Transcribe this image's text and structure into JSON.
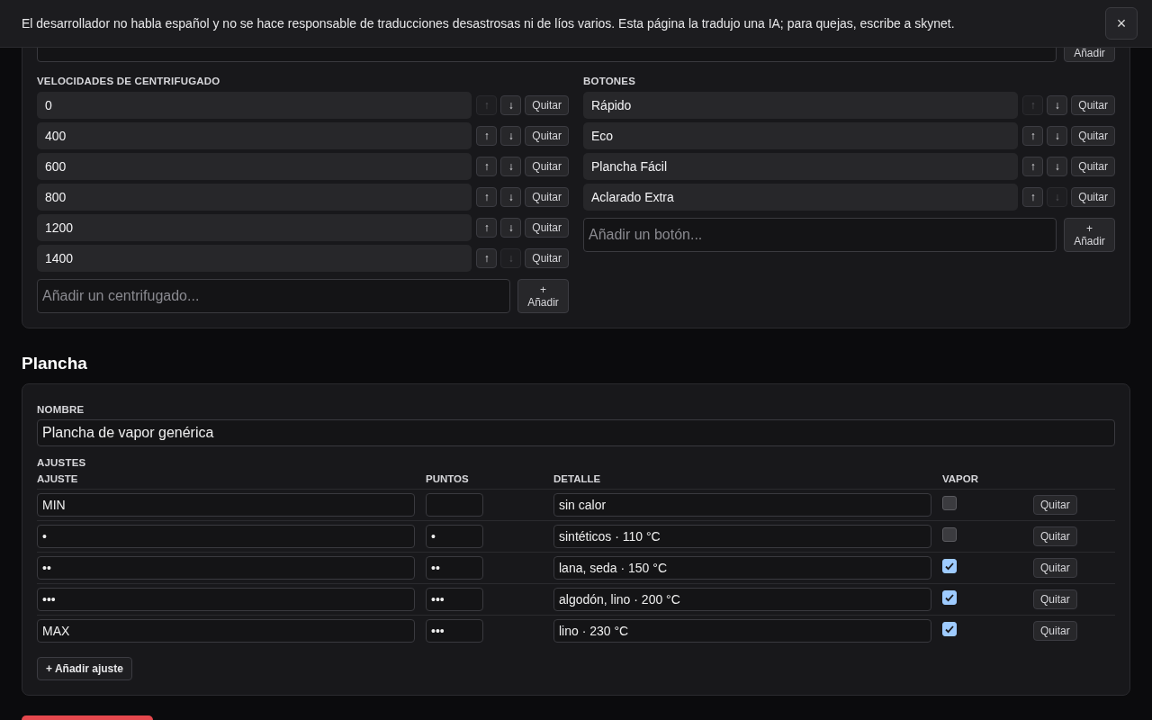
{
  "banner": {
    "text": "El desarrollador no habla español y no se hace responsable de traducciones desastrosas ni de líos varios. Esta página la tradujo una IA; para quejas, escribe a skynet.",
    "close": "×"
  },
  "programs_add": {
    "button": "Añadir"
  },
  "spins": {
    "title": "VELOCIDADES DE CENTRIFUGADO",
    "items": [
      {
        "value": "0",
        "up": "↑",
        "down": "↓",
        "remove": "Quitar",
        "up_disabled": true,
        "down_disabled": false
      },
      {
        "value": "400",
        "up": "↑",
        "down": "↓",
        "remove": "Quitar",
        "up_disabled": false,
        "down_disabled": false
      },
      {
        "value": "600",
        "up": "↑",
        "down": "↓",
        "remove": "Quitar",
        "up_disabled": false,
        "down_disabled": false
      },
      {
        "value": "800",
        "up": "↑",
        "down": "↓",
        "remove": "Quitar",
        "up_disabled": false,
        "down_disabled": false
      },
      {
        "value": "1200",
        "up": "↑",
        "down": "↓",
        "remove": "Quitar",
        "up_disabled": false,
        "down_disabled": false
      },
      {
        "value": "1400",
        "up": "↑",
        "down": "↓",
        "remove": "Quitar",
        "up_disabled": false,
        "down_disabled": true
      }
    ],
    "placeholder": "Añadir un centrifugado...",
    "add_plus": "+",
    "add": "Añadir"
  },
  "buttons": {
    "title": "BOTONES",
    "items": [
      {
        "value": "Rápido",
        "up": "↑",
        "down": "↓",
        "remove": "Quitar",
        "up_disabled": true,
        "down_disabled": false
      },
      {
        "value": "Eco",
        "up": "↑",
        "down": "↓",
        "remove": "Quitar",
        "up_disabled": false,
        "down_disabled": false
      },
      {
        "value": "Plancha Fácil",
        "up": "↑",
        "down": "↓",
        "remove": "Quitar",
        "up_disabled": false,
        "down_disabled": false
      },
      {
        "value": "Aclarado Extra",
        "up": "↑",
        "down": "↓",
        "remove": "Quitar",
        "up_disabled": false,
        "down_disabled": true
      }
    ],
    "placeholder": "Añadir un botón...",
    "add_plus": "+",
    "add": "Añadir"
  },
  "iron": {
    "heading": "Plancha",
    "name_label": "NOMBRE",
    "name": "Plancha de vapor genérica",
    "settings_label": "AJUSTES",
    "columns": [
      "AJUSTE",
      "PUNTOS",
      "DETALLE",
      "VAPOR"
    ],
    "rows": [
      {
        "setting": "MIN",
        "dots": "",
        "detail": "sin calor",
        "steam": false,
        "remove": "Quitar"
      },
      {
        "setting": "•",
        "dots": "•",
        "detail": "sintéticos · 110 °C",
        "steam": false,
        "remove": "Quitar"
      },
      {
        "setting": "••",
        "dots": "••",
        "detail": "lana, seda · 150 °C",
        "steam": true,
        "remove": "Quitar"
      },
      {
        "setting": "•••",
        "dots": "•••",
        "detail": "algodón, lino · 200 °C",
        "steam": true,
        "remove": "Quitar"
      },
      {
        "setting": "MAX",
        "dots": "•••",
        "detail": "lino · 230 °C",
        "steam": true,
        "remove": "Quitar"
      }
    ],
    "add": "+ Añadir ajuste"
  }
}
